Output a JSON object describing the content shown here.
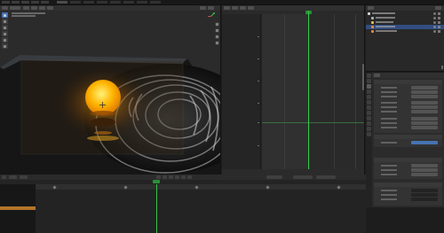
{
  "colors": {
    "accent": "#4772b3",
    "playhead": "#37c54a",
    "selection": "#334d80",
    "keyframe": "#e8a33a",
    "bulb_glow": "#ffb000"
  },
  "icons": {
    "tools": [
      "cursor-icon",
      "move-icon",
      "rotate-icon",
      "scale-icon",
      "transform-icon",
      "annotate-icon"
    ],
    "navigation": [
      "zoom-icon",
      "pan-icon",
      "camera-view-icon",
      "perspective-icon"
    ]
  },
  "playhead": {
    "frame_fraction_graph": 0.45,
    "frame_fraction_timeline": 0.33
  },
  "outliner": {
    "rows": [
      {
        "name": "collection",
        "icon_color": "#d6d6d6",
        "selected": false
      },
      {
        "name": "camera",
        "icon_color": "#b0b0b0",
        "selected": false
      },
      {
        "name": "light",
        "icon_color": "#e0c060",
        "selected": false
      },
      {
        "name": "bulb",
        "icon_color": "#e08c3a",
        "selected": true
      },
      {
        "name": "ground",
        "icon_color": "#e08c3a",
        "selected": false
      }
    ]
  },
  "properties": {
    "active_tab": 2
  }
}
